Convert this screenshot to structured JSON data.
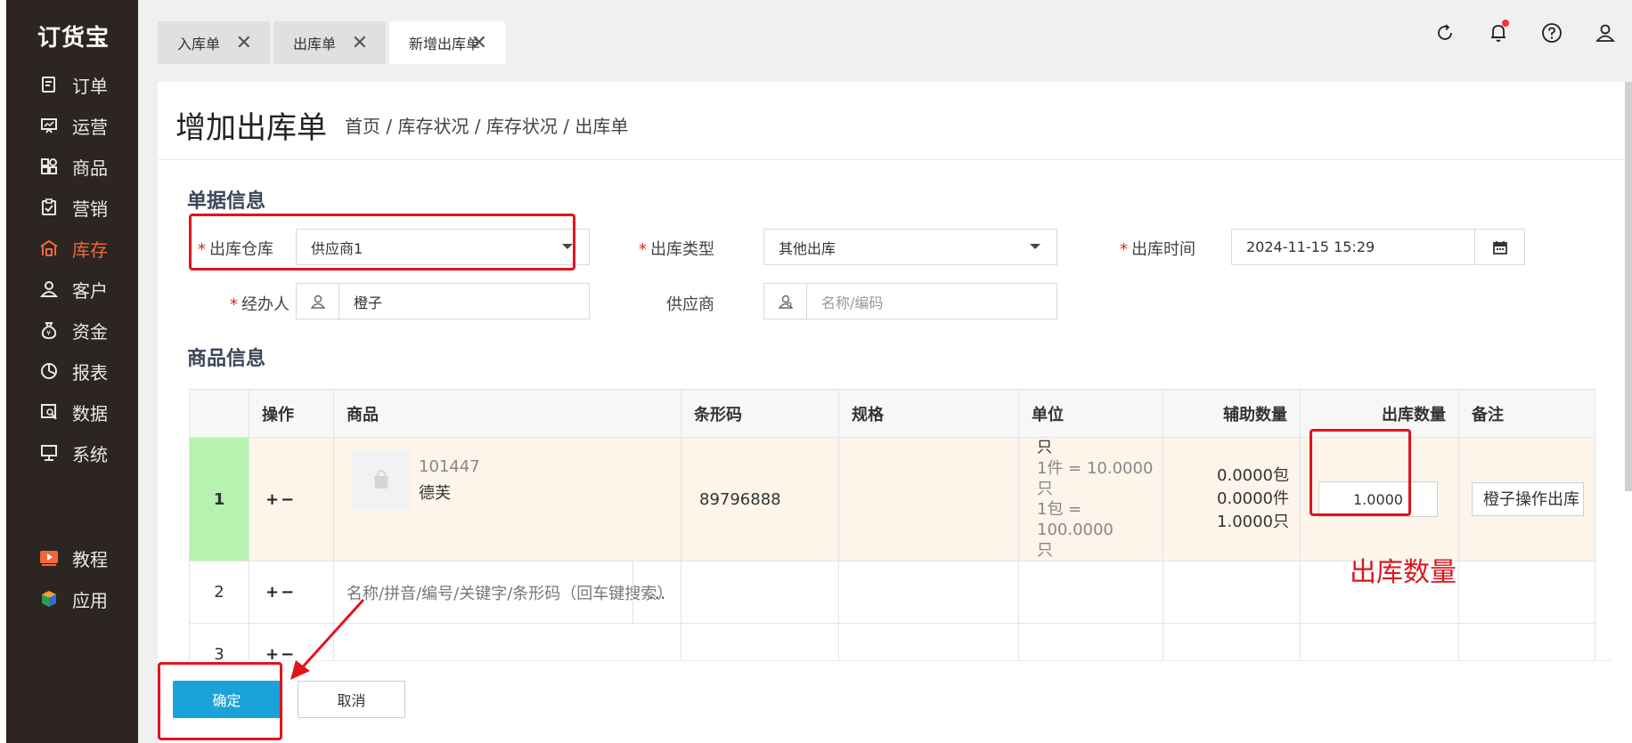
{
  "app": {
    "logo": "订货宝"
  },
  "sidebar": {
    "items": [
      {
        "label": "订单",
        "icon": "order-icon",
        "active": false
      },
      {
        "label": "运营",
        "icon": "presentation-icon",
        "active": false
      },
      {
        "label": "商品",
        "icon": "grid-icon",
        "active": false
      },
      {
        "label": "营销",
        "icon": "clipboard-check-icon",
        "active": false
      },
      {
        "label": "库存",
        "icon": "warehouse-icon",
        "active": true
      },
      {
        "label": "客户",
        "icon": "user-icon",
        "active": false
      },
      {
        "label": "资金",
        "icon": "money-bag-icon",
        "active": false
      },
      {
        "label": "报表",
        "icon": "pie-chart-icon",
        "active": false
      },
      {
        "label": "数据",
        "icon": "data-search-icon",
        "active": false
      },
      {
        "label": "系统",
        "icon": "monitor-icon",
        "active": false
      }
    ],
    "bottom_items": [
      {
        "label": "教程",
        "icon": "play-icon"
      },
      {
        "label": "应用",
        "icon": "cube-icon"
      }
    ]
  },
  "tabs": [
    {
      "label": "入库单",
      "active": false
    },
    {
      "label": "出库单",
      "active": false
    },
    {
      "label": "新增出库单",
      "active": true
    }
  ],
  "topbar_icons": [
    "refresh-icon",
    "bell-icon",
    "help-icon",
    "user-icon"
  ],
  "page": {
    "title": "增加出库单",
    "breadcrumb": "首页 / 库存状况 / 库存状况 / 出库单"
  },
  "form": {
    "section_title": "单据信息",
    "warehouse": {
      "label": "出库仓库",
      "value": "供应商1"
    },
    "type": {
      "label": "出库类型",
      "value": "其他出库"
    },
    "time": {
      "label": "出库时间",
      "value": "2024-11-15 15:29"
    },
    "handler": {
      "label": "经办人",
      "value": "橙子"
    },
    "supplier": {
      "label": "供应商",
      "placeholder": "名称/编码"
    }
  },
  "goods": {
    "section_title": "商品信息",
    "columns": {
      "op": "操作",
      "product": "商品",
      "barcode": "条形码",
      "spec": "规格",
      "unit": "单位",
      "aux_qty": "辅助数量",
      "out_qty": "出库数量",
      "note": "备注"
    },
    "op_symbol": "+−",
    "row1": {
      "num": "1",
      "code": "101447",
      "name": "德芙",
      "barcode": "89796888",
      "spec": "",
      "unit_main": "只",
      "unit_conv1": "1件 = 10.0000只",
      "unit_conv2": "1包 = 100.0000",
      "unit_conv3": "只",
      "aux1": "0.0000包",
      "aux2": "0.0000件",
      "aux3": "1.0000只",
      "qty": "1.0000",
      "note": "橙子操作出库"
    },
    "row2": {
      "num": "2",
      "search_placeholder": "名称/拼音/编号/关键字/条形码（回车键搜索）",
      "more": "…"
    },
    "row3": {
      "num": "3"
    }
  },
  "footer": {
    "ok": "确定",
    "cancel": "取消"
  },
  "annotation": {
    "text": "出库数量",
    "color": "#e0141d"
  }
}
